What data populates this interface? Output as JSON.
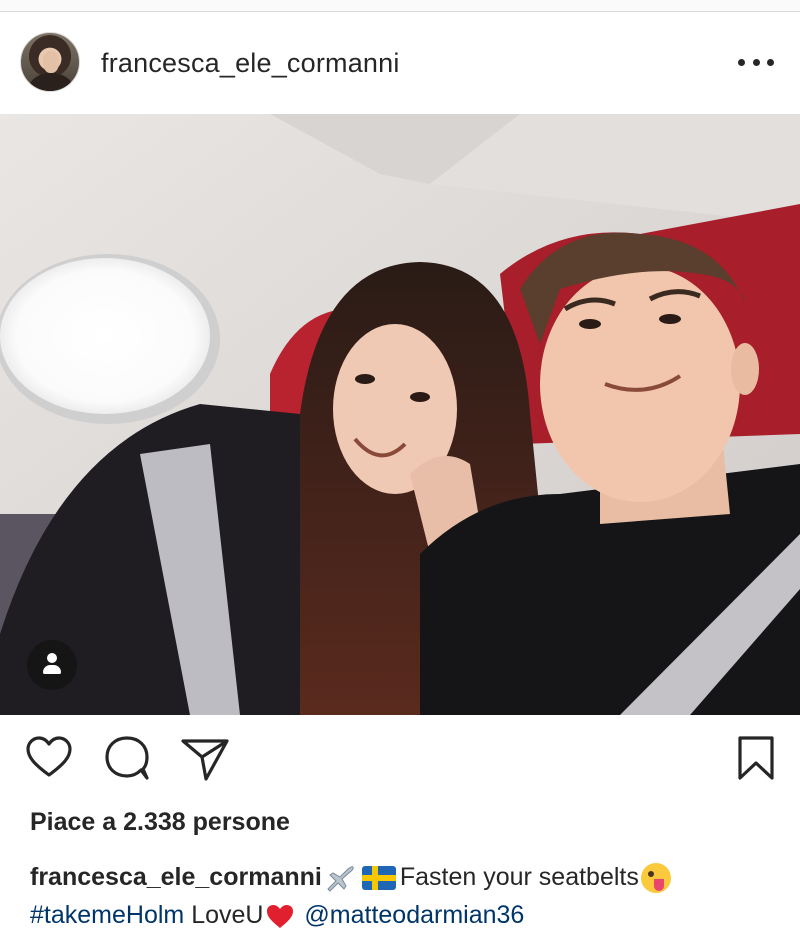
{
  "post": {
    "username": "francesca_ele_cormanni",
    "likes_prefix": "Piace a",
    "likes_count": "2.338",
    "likes_suffix": "persone",
    "caption": {
      "username": "francesca_ele_cormanni",
      "text": "Fasten your seatbelts",
      "hashtag": "#takemeHolm",
      "love_text": "LoveU",
      "mention": "@matteodarmian36"
    },
    "icons": {
      "more": "more-options-icon",
      "like": "heart-icon",
      "comment": "comment-icon",
      "share": "share-icon",
      "save": "bookmark-icon",
      "user_tag": "user-tag-icon"
    },
    "colors": {
      "text": "#262626",
      "link": "#003569",
      "seat_red": "#b8232f"
    }
  }
}
